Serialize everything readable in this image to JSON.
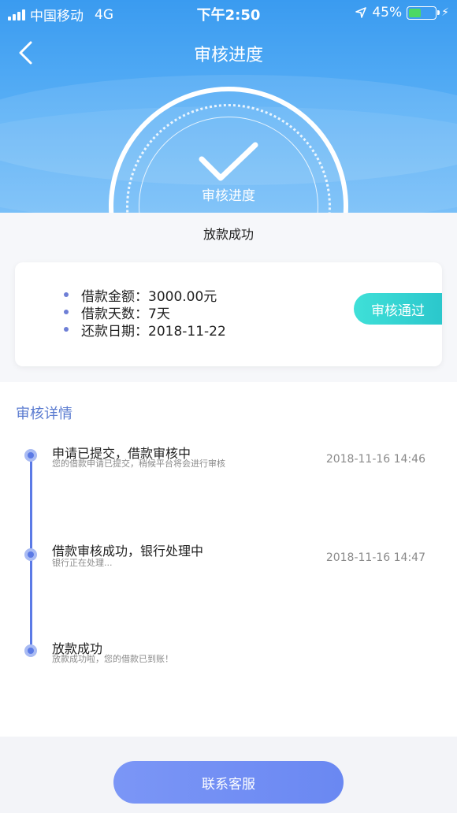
{
  "status_bar": {
    "carrier": "中国移动",
    "network": "4G",
    "time": "下午2:50",
    "battery": "45%",
    "battery_level": 0.45
  },
  "nav": {
    "title": "审核进度"
  },
  "progress_ring": {
    "label": "审核进度"
  },
  "status": {
    "title": "放款成功"
  },
  "loan_card": {
    "items": [
      {
        "text": "借款金额：3000.00元"
      },
      {
        "text": "借款天数：7天"
      },
      {
        "text": "还款日期：2018-11-22"
      }
    ],
    "badge": "审核通过"
  },
  "details": {
    "title": "审核详情",
    "steps": [
      {
        "title": "申请已提交，借款审核中",
        "subtitle": "您的借款申请已提交，稍候平台将会进行审核",
        "time": "2018-11-16 14:46"
      },
      {
        "title": "借款审核成功，银行处理中",
        "subtitle": "银行正在处理...",
        "time": "2018-11-16 14:47"
      },
      {
        "title": "放款成功",
        "subtitle": "放款成功啦，您的借款已到账！",
        "time": ""
      }
    ]
  },
  "footer": {
    "contact_label": "联系客服"
  },
  "colors": {
    "header_blue": "#3a9bf0",
    "accent_indigo": "#5b7ae6",
    "badge_teal": "#2bc7cc",
    "battery_green": "#4cd964"
  }
}
